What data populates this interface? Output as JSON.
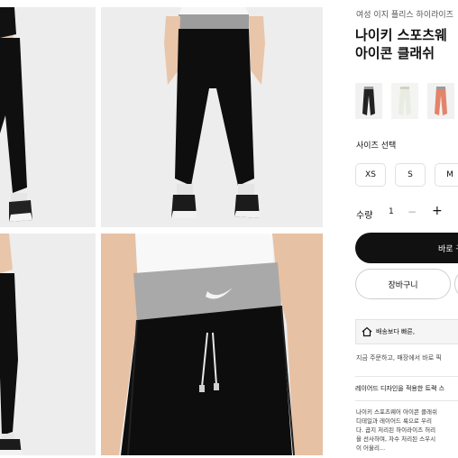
{
  "product": {
    "subtitle": "여성 이지 플리스 하이라이즈",
    "title_line1": "나이키 스포츠웨",
    "title_line2": "아이콘 클래쉬"
  },
  "colors": {
    "accent": "#111111",
    "swatches": [
      "#222222",
      "#e9ece3",
      "#e3836a"
    ]
  },
  "variants": [
    {
      "name": "black"
    },
    {
      "name": "cream"
    },
    {
      "name": "coral"
    }
  ],
  "size": {
    "label": "사이즈 선택",
    "options": [
      "XS",
      "S",
      "M"
    ]
  },
  "quantity": {
    "label": "수량",
    "value": "1",
    "minus": "−",
    "plus": "+"
  },
  "actions": {
    "buy": "바로 구",
    "cart": "장바구니"
  },
  "delivery": {
    "box_text": "배송보다 빠른,",
    "pickup_text": "지금 주문하고, 매장에서 바로 픽"
  },
  "description": {
    "heading": "레이어드 디자인을 적용한 트랙 스",
    "lines": [
      "나이키 스포츠웨어 아이콘 클래쉬",
      "디테일과 레이어드 룩으로 우리",
      "다. 곱지 처리된 하이라이즈 허리",
      "을 선사하며, 자수 처리된 스우시",
      "이 어울리..."
    ]
  }
}
